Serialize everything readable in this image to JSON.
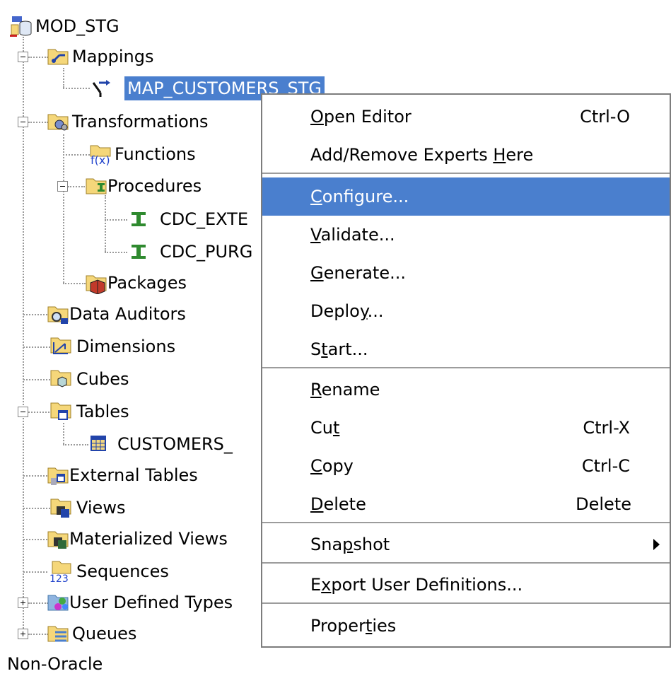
{
  "tree": {
    "root": "MOD_STG",
    "nodes": {
      "mappings": "Mappings",
      "map_customers": "MAP_CUSTOMERS_STG",
      "transformations": "Transformations",
      "functions": "Functions",
      "procedures": "Procedures",
      "cdc_exte": "CDC_EXTE",
      "cdc_purg": "CDC_PURG",
      "packages": "Packages",
      "data_auditors": "Data Auditors",
      "dimensions": "Dimensions",
      "cubes": "Cubes",
      "tables": "Tables",
      "customers": "CUSTOMERS_",
      "external_tables": "External Tables",
      "views": "Views",
      "materialized_views": "Materialized Views",
      "sequences": "Sequences",
      "user_defined_types": "User Defined Types",
      "queues": "Queues"
    },
    "bottom_label": "Non-Oracle"
  },
  "menu": {
    "open_editor": {
      "pre": "",
      "key": "O",
      "post": "pen Editor",
      "shortcut": "Ctrl-O"
    },
    "add_remove": {
      "pre": "Add/Remove Experts ",
      "key": "H",
      "post": "ere"
    },
    "configure": {
      "pre": "",
      "key": "C",
      "post": "onfigure..."
    },
    "validate": {
      "pre": "",
      "key": "V",
      "post": "alidate..."
    },
    "generate": {
      "pre": "",
      "key": "G",
      "post": "enerate..."
    },
    "deploy": {
      "pre": "Deplo",
      "key": "y",
      "post": "..."
    },
    "start": {
      "pre": "S",
      "key": "t",
      "post": "art..."
    },
    "rename": {
      "pre": "",
      "key": "R",
      "post": "ename"
    },
    "cut": {
      "pre": "Cu",
      "key": "t",
      "post": "",
      "shortcut": "Ctrl-X"
    },
    "copy": {
      "pre": "",
      "key": "C",
      "post": "opy",
      "shortcut": "Ctrl-C"
    },
    "delete": {
      "pre": "",
      "key": "D",
      "post": "elete",
      "shortcut": "Delete"
    },
    "snapshot": {
      "pre": "Sna",
      "key": "p",
      "post": "shot"
    },
    "export": {
      "pre": "E",
      "key": "x",
      "post": "port User Definitions..."
    },
    "properties": {
      "pre": "Proper",
      "key": "t",
      "post": "ies"
    }
  },
  "colors": {
    "selection": "#4a7fce",
    "folder": "#f5d77a",
    "icon_green": "#2f8a2f"
  }
}
